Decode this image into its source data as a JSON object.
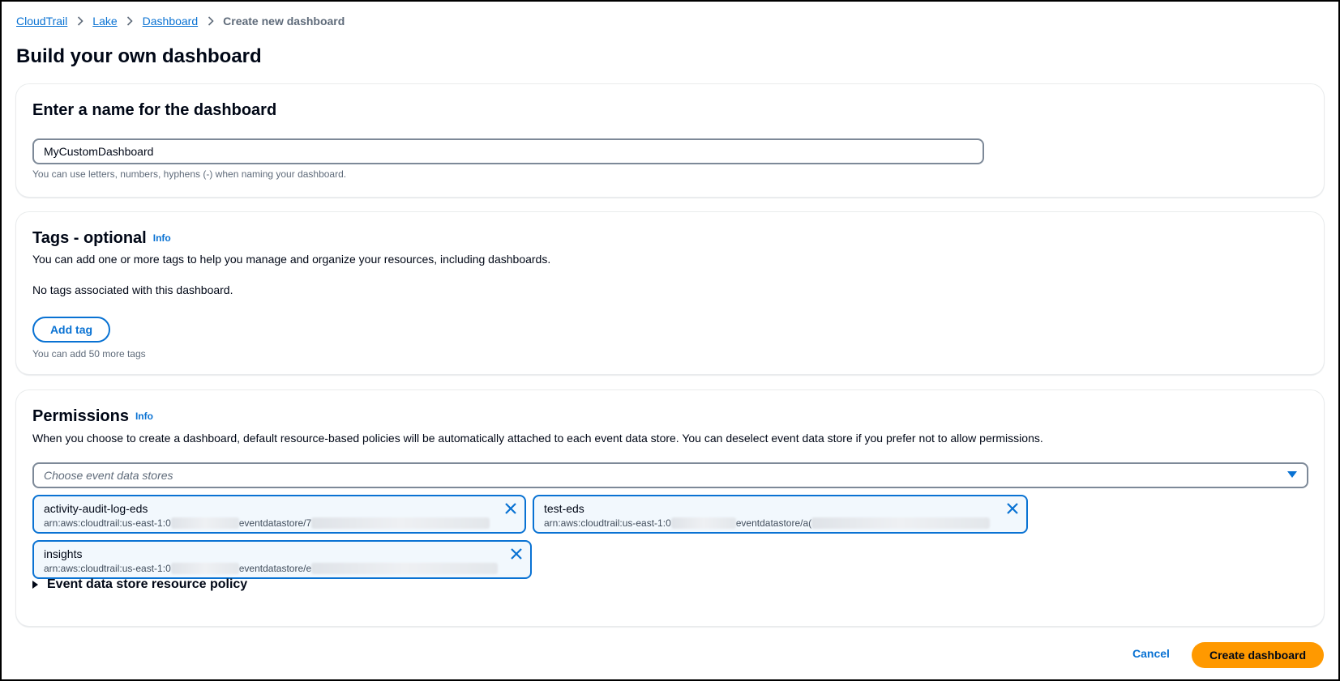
{
  "breadcrumb": {
    "items": [
      "CloudTrail",
      "Lake",
      "Dashboard"
    ],
    "current": "Create new dashboard"
  },
  "page": {
    "title": "Build your own dashboard"
  },
  "name_section": {
    "title": "Enter a name for the dashboard",
    "input_value": "MyCustomDashboard",
    "hint": "You can use letters, numbers, hyphens (-) when naming your dashboard."
  },
  "tags_section": {
    "title": "Tags - optional",
    "info": "Info",
    "description": "You can add one or more tags to help you manage and organize your resources, including dashboards.",
    "empty_text": "No tags associated with this dashboard.",
    "add_tag_label": "Add tag",
    "hint": "You can add 50 more tags"
  },
  "permissions_section": {
    "title": "Permissions",
    "info": "Info",
    "description": "When you choose to create a dashboard, default resource-based policies will be automatically attached to each event data store. You can deselect event data store if you prefer not to allow permissions.",
    "select_placeholder": "Choose event data stores",
    "tokens": [
      {
        "name": "activity-audit-log-eds",
        "arn_prefix": "arn:aws:cloudtrail:us-east-1:0",
        "arn_mid": "eventdatastore/7"
      },
      {
        "name": "test-eds",
        "arn_prefix": "arn:aws:cloudtrail:us-east-1:0",
        "arn_mid": "eventdatastore/a("
      },
      {
        "name": "insights",
        "arn_prefix": "arn:aws:cloudtrail:us-east-1:0",
        "arn_mid": "eventdatastore/e"
      }
    ],
    "expander_label": "Event data store resource policy"
  },
  "footer": {
    "cancel_label": "Cancel",
    "create_label": "Create dashboard"
  },
  "colors": {
    "link": "#0972d3",
    "primary": "#ff9900",
    "text": "#000716",
    "muted": "#5f6b7a"
  }
}
